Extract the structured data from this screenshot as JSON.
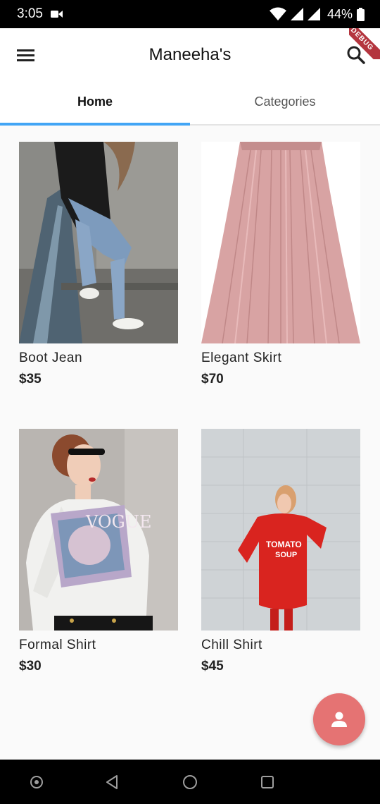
{
  "status_bar": {
    "time": "3:05",
    "battery": "44%",
    "icons": [
      "video-icon",
      "wifi-icon",
      "signal-icon",
      "signal-icon",
      "battery-icon"
    ]
  },
  "app_bar": {
    "title": "Maneeha's",
    "debug_banner": "DEBUG",
    "icons": [
      "menu-icon",
      "search-icon"
    ]
  },
  "tabs": [
    {
      "label": "Home",
      "active": true
    },
    {
      "label": "Categories",
      "active": false
    }
  ],
  "products": [
    {
      "name": "Boot Jean",
      "price": "$35",
      "image": "woman-jeans-photo"
    },
    {
      "name": "Elegant Skirt",
      "price": "$70",
      "image": "pink-skirt-photo"
    },
    {
      "name": "Formal Shirt",
      "price": "$30",
      "image": "white-shirt-photo"
    },
    {
      "name": "Chill Shirt",
      "price": "$45",
      "image": "red-sweatshirt-photo"
    }
  ],
  "fab": {
    "icon": "person-icon"
  },
  "nav_bar": {
    "icons": [
      "assistant-icon",
      "back-icon",
      "home-icon",
      "recents-icon"
    ]
  },
  "colors": {
    "accent": "#42a5f5",
    "fab": "#e57373",
    "banner": "#b4353e",
    "background": "#fafafa"
  }
}
